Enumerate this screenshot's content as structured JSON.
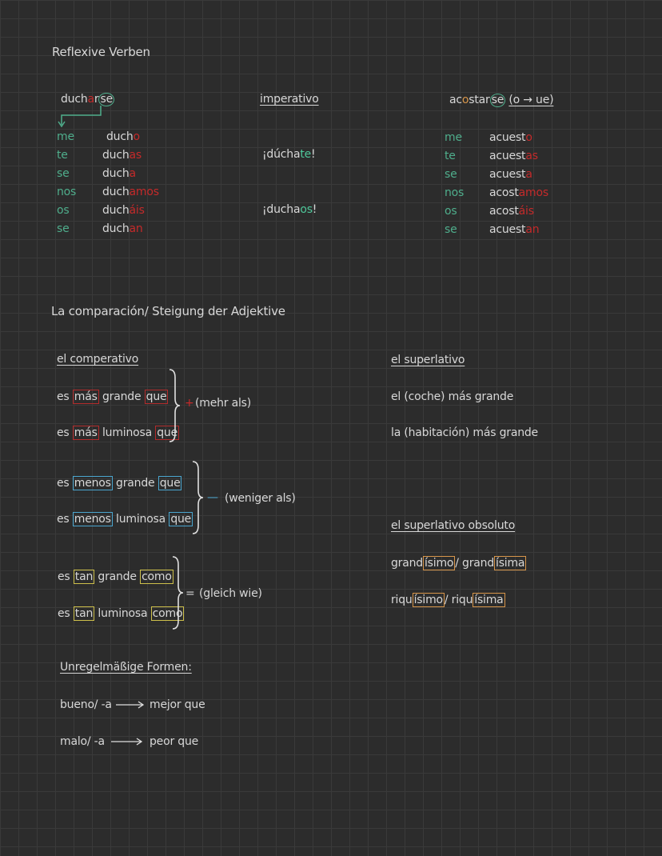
{
  "section1": {
    "title": "Reflexive Verben",
    "ducharse": {
      "stem": "duch",
      "a": "a",
      "r": "r",
      "se": "se",
      "pronouns": [
        "me",
        "te",
        "se",
        "nos",
        "os",
        "se"
      ],
      "forms": [
        {
          "stem": "duch",
          "ending": "o"
        },
        {
          "stem": "duch",
          "ending": "as"
        },
        {
          "stem": "duch",
          "ending": "a"
        },
        {
          "stem": "duch",
          "ending": "amos"
        },
        {
          "stem": "duch",
          "ending": "áis"
        },
        {
          "stem": "duch",
          "ending": "an"
        }
      ]
    },
    "imperativo": {
      "heading": "imperativo",
      "tu": {
        "pre": "¡dúcha",
        "hi": "te",
        "post": "!"
      },
      "vos": {
        "pre": "¡ducha",
        "hi": "os",
        "post": "!"
      }
    },
    "acostarse": {
      "pre": "ac",
      "o": "o",
      "mid": "star",
      "se": "se",
      "note": "(o → ue)",
      "pronouns": [
        "me",
        "te",
        "se",
        "nos",
        "os",
        "se"
      ],
      "forms": [
        {
          "stem": "acuest",
          "ending": "o"
        },
        {
          "stem": "acuest",
          "ending": "as"
        },
        {
          "stem": "acuest",
          "ending": "a"
        },
        {
          "stem": "acost",
          "ending": "amos"
        },
        {
          "stem": "acost",
          "ending": "áis"
        },
        {
          "stem": "acuest",
          "ending": "an"
        }
      ]
    }
  },
  "section2": {
    "title": "La comparación/ Steigung der Adjektive",
    "comparativo": {
      "heading": "el comperativo",
      "mas": {
        "l1": {
          "pre": "es",
          "box1": "más",
          "mid": "grande",
          "box2": "que"
        },
        "l2": {
          "pre": "es",
          "box1": "más",
          "mid": "luminosa",
          "box2": "que"
        },
        "sym": "+",
        "meaning": "(mehr  als)"
      },
      "menos": {
        "l1": {
          "pre": "es",
          "box1": "menos",
          "mid": "grande",
          "box2": "que"
        },
        "l2": {
          "pre": "es",
          "box1": "menos",
          "mid": "luminosa",
          "box2": "que"
        },
        "sym": "—",
        "meaning": "(weniger  als)"
      },
      "tan": {
        "l1": {
          "pre": "es",
          "box1": "tan",
          "mid": "grande",
          "box2": "como"
        },
        "l2": {
          "pre": "es",
          "box1": "tan",
          "mid": "luminosa",
          "box2": "como"
        },
        "sym": "=",
        "meaning": "(gleich  wie)"
      }
    },
    "superlativo": {
      "heading": "el superlativo",
      "ex1": "el (coche) más grande",
      "ex2": "la (habitación) más grande"
    },
    "absoluto": {
      "heading": "el superlativo obsoluto",
      "l1": {
        "a": "grand",
        "b": "ísimo",
        "c": "/ grand",
        "d": "ísima"
      },
      "l2": {
        "a": "riqu",
        "b": "ísimo",
        "c": "/ riqu",
        "d": "ísima"
      }
    },
    "irregular": {
      "heading": "Unregelmäßige Formen:",
      "r1": {
        "left": "bueno/ -a",
        "right": "mejor que"
      },
      "r2": {
        "left": "malo/ -a",
        "right": "peor que"
      }
    }
  },
  "colors": {
    "red": "#c52a2a",
    "teal": "#4fc79a",
    "blue": "#4aa6cf",
    "yellow": "#cdbf4a",
    "orange": "#d7954a"
  }
}
